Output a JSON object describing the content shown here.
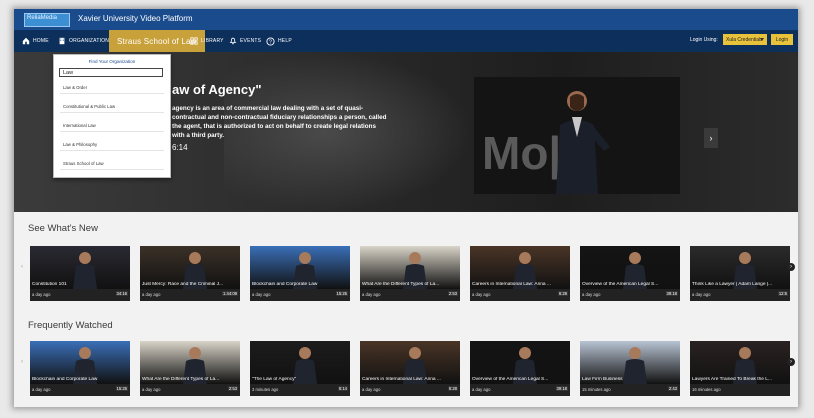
{
  "header": {
    "logo_text": "ReliaMedia",
    "title": "Xavier University Video Platform"
  },
  "nav": {
    "home": "HOME",
    "organization": "ORGANIZATION",
    "active_org": "Straus School of Law",
    "library": "LIBRARY",
    "events": "EVENTS",
    "help": "HELP",
    "login_label": "Login Using:",
    "login_select": "Xula Credentials",
    "login_button": "Login"
  },
  "dropdown": {
    "heading": "Find Your Organization",
    "input_value": "Law",
    "items": [
      "Law & Order",
      "Constitutional & Public Law",
      "International Law",
      "Law & Philosophy",
      "Straus School of Law"
    ]
  },
  "hero": {
    "title": "aw of Agency\"",
    "description": "agency is an area of commercial law dealing with a set of quasi-contractual and non-contractual fiduciary relationships a person, called the agent, that is authorized to act on behalf to create legal relations with a third party.",
    "duration": "6:14",
    "next_glyph": "›",
    "video_text": "Mo||"
  },
  "sections": [
    {
      "title": "See What's New",
      "videos": [
        {
          "title": "Constitution 101",
          "age": "a day ago",
          "duration": "34:16",
          "color": "#2a2a33"
        },
        {
          "title": "Just Mercy: Race and the Criminal J...",
          "age": "a day ago",
          "duration": "1:44:09",
          "color": "#3b3128"
        },
        {
          "title": "Blockchain and Corporate Law",
          "age": "a day ago",
          "duration": "15:25",
          "color": "#3a6fb8"
        },
        {
          "title": "What Are the Different Types of La...",
          "age": "a day ago",
          "duration": "2:53",
          "color": "#d9d4c8"
        },
        {
          "title": "Careers in International Law: Anna ...",
          "age": "a day ago",
          "duration": "6:28",
          "color": "#4a3527"
        },
        {
          "title": "Overview of the American Legal S...",
          "age": "a day ago",
          "duration": "39:18",
          "color": "#141414"
        },
        {
          "title": "Think Like a Lawyer | Adam Lange |...",
          "age": "a day ago",
          "duration": "12:5",
          "color": "#2b2b2b"
        }
      ]
    },
    {
      "title": "Frequently Watched",
      "videos": [
        {
          "title": "Blockchain and Corporate Law",
          "age": "a day ago",
          "duration": "15:25",
          "color": "#3a6fb8"
        },
        {
          "title": "What Are the Different Types of La...",
          "age": "a day ago",
          "duration": "2:53",
          "color": "#d9d4c8"
        },
        {
          "title": "\"The Law of Agency\"",
          "age": "3 minutes ago",
          "duration": "6:14",
          "color": "#1c1c1c"
        },
        {
          "title": "Careers in International Law: Anna ...",
          "age": "a day ago",
          "duration": "6:28",
          "color": "#4a3527"
        },
        {
          "title": "Overview of the American Legal S...",
          "age": "a day ago",
          "duration": "39:18",
          "color": "#141414"
        },
        {
          "title": "Law Firm Business",
          "age": "15 minutes ago",
          "duration": "2:43",
          "color": "#b8c4d4"
        },
        {
          "title": "Lawyers Are Trained To Break the L...",
          "age": "16 minutes ago",
          "duration": "",
          "color": "#2a2222"
        }
      ]
    }
  ],
  "arrows": {
    "left": "‹",
    "right": "›"
  }
}
